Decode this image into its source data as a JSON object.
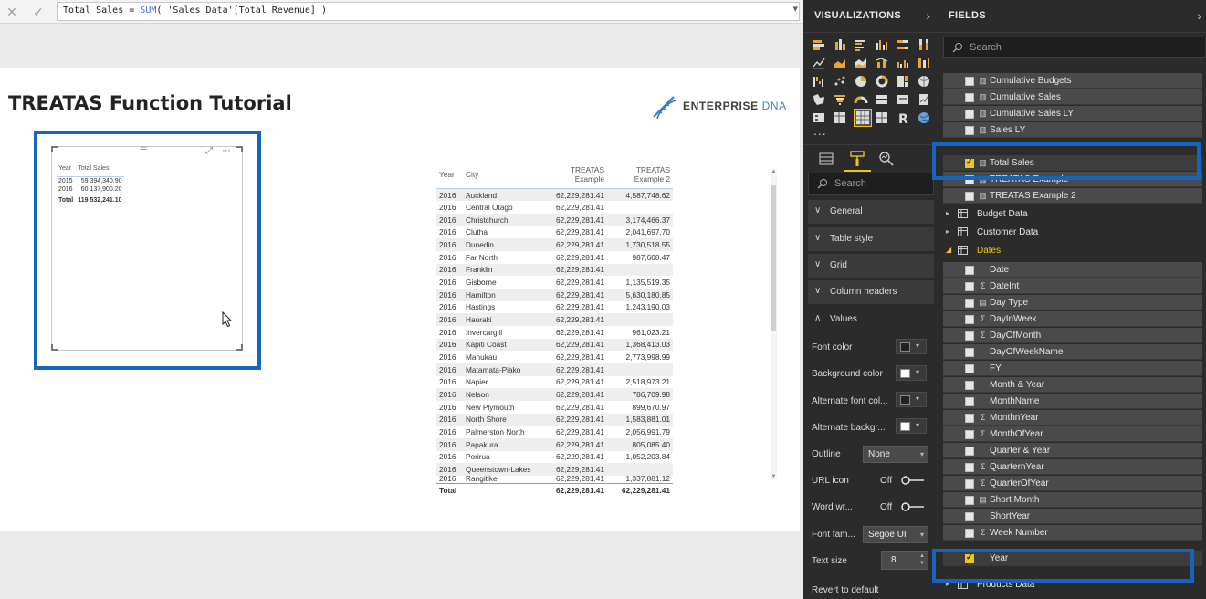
{
  "formula_bar": {
    "cancel_icon": "close-icon",
    "commit_icon": "check-icon",
    "measure_name": "Total Sales = ",
    "function": "SUM",
    "argument": "( 'Sales Data'[Total Revenue] )"
  },
  "report": {
    "title": "TREATAS Function Tutorial",
    "logo": {
      "word1": "ENTERPRISE",
      "word2": "DNA"
    },
    "small_table": {
      "headers": [
        "Year",
        "Total Sales"
      ],
      "rows": [
        [
          "2015",
          "59,394,340.90"
        ],
        [
          "2016",
          "60,137,900.20"
        ]
      ],
      "total": [
        "Total",
        "119,532,241.10"
      ]
    },
    "big_table": {
      "headers": [
        "Year",
        "City",
        "TREATAS Example",
        "TREATAS Example 2"
      ],
      "rows": [
        [
          "2016",
          "Auckland",
          "62,229,281.41",
          "4,587,748.62"
        ],
        [
          "2016",
          "Central Otago",
          "62,229,281.41",
          ""
        ],
        [
          "2016",
          "Christchurch",
          "62,229,281.41",
          "3,174,466.37"
        ],
        [
          "2016",
          "Clutha",
          "62,229,281.41",
          "2,041,697.70"
        ],
        [
          "2016",
          "Dunedin",
          "62,229,281.41",
          "1,730,518.55"
        ],
        [
          "2016",
          "Far North",
          "62,229,281.41",
          "987,608.47"
        ],
        [
          "2016",
          "Franklin",
          "62,229,281.41",
          ""
        ],
        [
          "2016",
          "Gisborne",
          "62,229,281.41",
          "1,135,519.35"
        ],
        [
          "2016",
          "Hamilton",
          "62,229,281.41",
          "5,630,180.85"
        ],
        [
          "2016",
          "Hastings",
          "62,229,281.41",
          "1,243,190.03"
        ],
        [
          "2016",
          "Hauraki",
          "62,229,281.41",
          ""
        ],
        [
          "2016",
          "Invercargill",
          "62,229,281.41",
          "961,023.21"
        ],
        [
          "2016",
          "Kapiti Coast",
          "62,229,281.41",
          "1,368,413.03"
        ],
        [
          "2016",
          "Manukau",
          "62,229,281.41",
          "2,773,998.99"
        ],
        [
          "2016",
          "Matamata-Piako",
          "62,229,281.41",
          ""
        ],
        [
          "2016",
          "Napier",
          "62,229,281.41",
          "2,518,973.21"
        ],
        [
          "2016",
          "Nelson",
          "62,229,281.41",
          "786,709.98"
        ],
        [
          "2016",
          "New Plymouth",
          "62,229,281.41",
          "899,670.97"
        ],
        [
          "2016",
          "North Shore",
          "62,229,281.41",
          "1,583,881.01"
        ],
        [
          "2016",
          "Palmerston North",
          "62,229,281.41",
          "2,056,991.79"
        ],
        [
          "2016",
          "Papakura",
          "62,229,281.41",
          "805,085.40"
        ],
        [
          "2016",
          "Porirua",
          "62,229,281.41",
          "1,052,203.84"
        ],
        [
          "2016",
          "Queenstown-Lakes",
          "62,229,281.41",
          ""
        ],
        [
          "2016",
          "Rangitikei",
          "62,229,281.41",
          "1,337,881.12"
        ]
      ],
      "total": [
        "Total",
        "",
        "62,229,281.41",
        "62,229,281.41"
      ]
    }
  },
  "visualizations": {
    "title": "VISUALIZATIONS",
    "more": "...",
    "search_placeholder": "Search",
    "sections": [
      "General",
      "Table style",
      "Grid",
      "Column headers",
      "Values"
    ],
    "properties": {
      "font_color": "Font color",
      "background_color": "Background color",
      "alt_font_color": "Alternate font col...",
      "alt_background": "Alternate backgr...",
      "outline": "Outline",
      "outline_value": "None",
      "url_icon": "URL icon",
      "url_icon_state": "Off",
      "word_wrap": "Word wr...",
      "word_wrap_state": "Off",
      "font_family": "Font fam...",
      "font_family_value": "Segoe UI",
      "text_size": "Text size",
      "text_size_value": "8"
    },
    "revert": "Revert to default",
    "colors": {
      "font": "#222222",
      "background": "#ffffff",
      "alt_font": "#222222",
      "alt_background": "#ffffff"
    }
  },
  "fields": {
    "title": "FIELDS",
    "search_placeholder": "Search",
    "measures": [
      {
        "label": "Cumulative Budgets",
        "checked": false
      },
      {
        "label": "Cumulative Sales",
        "checked": false
      },
      {
        "label": "Cumulative Sales LY",
        "checked": false
      },
      {
        "label": "Sales LY",
        "checked": false
      },
      {
        "label": "Total Sales",
        "checked": true
      },
      {
        "label": "TREATAS Example",
        "checked": false
      },
      {
        "label": "TREATAS Example 2",
        "checked": false
      }
    ],
    "tables": [
      "Budget Data",
      "Customer Data",
      "Dates"
    ],
    "date_fields": [
      {
        "label": "Date",
        "icon": "",
        "checked": false
      },
      {
        "label": "DateInt",
        "icon": "Σ",
        "checked": false
      },
      {
        "label": "Day Type",
        "icon": "calc",
        "checked": false
      },
      {
        "label": "DayInWeek",
        "icon": "Σ",
        "checked": false
      },
      {
        "label": "DayOfMonth",
        "icon": "Σ",
        "checked": false
      },
      {
        "label": "DayOfWeekName",
        "icon": "",
        "checked": false
      },
      {
        "label": "FY",
        "icon": "",
        "checked": false
      },
      {
        "label": "Month & Year",
        "icon": "",
        "checked": false
      },
      {
        "label": "MonthName",
        "icon": "",
        "checked": false
      },
      {
        "label": "MonthnYear",
        "icon": "Σ",
        "checked": false
      },
      {
        "label": "MonthOfYear",
        "icon": "Σ",
        "checked": false
      },
      {
        "label": "Quarter & Year",
        "icon": "",
        "checked": false
      },
      {
        "label": "QuarternYear",
        "icon": "Σ",
        "checked": false
      },
      {
        "label": "QuarterOfYear",
        "icon": "Σ",
        "checked": false
      },
      {
        "label": "Short Month",
        "icon": "calc",
        "checked": false
      },
      {
        "label": "ShortYear",
        "icon": "",
        "checked": false
      },
      {
        "label": "Week Number",
        "icon": "Σ",
        "checked": false
      },
      {
        "label": "Year",
        "icon": "",
        "checked": true
      }
    ],
    "last_table": "Products Data"
  },
  "colors": {
    "highlight": "#1565c0",
    "checked": "#f0c419",
    "pane_bg": "#2b2b2b",
    "row_bg": "#4a4a4a"
  }
}
